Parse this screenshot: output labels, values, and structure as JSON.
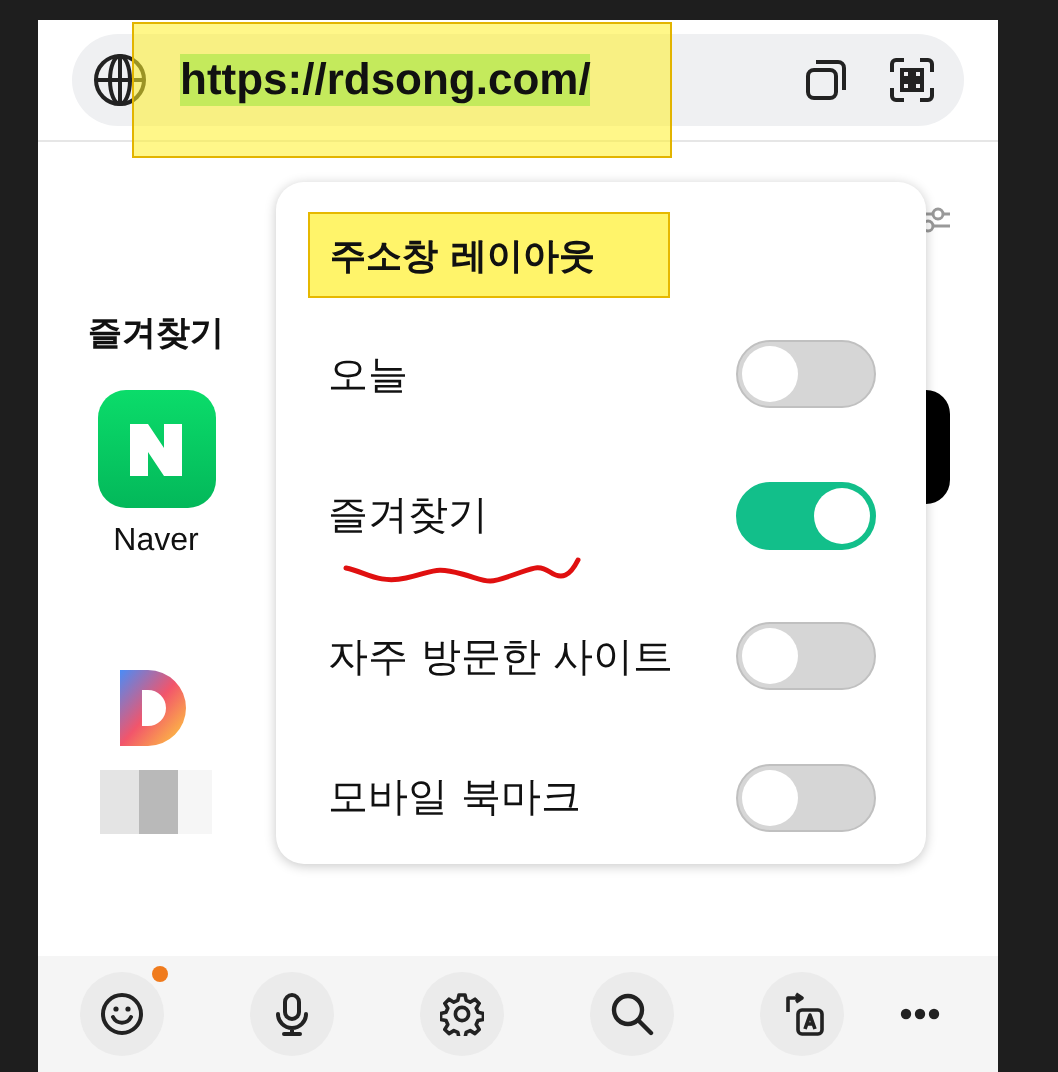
{
  "address_bar": {
    "url": "https://rdsong.com/",
    "highlighted": true
  },
  "favorites": {
    "title": "즐겨찾기",
    "items": [
      {
        "kind": "naver",
        "label": "Naver"
      },
      {
        "kind": "daum"
      }
    ]
  },
  "popup": {
    "title": "주소창 레이아웃",
    "highlighted": true,
    "options": [
      {
        "label": "오늘",
        "on": false,
        "underlined": false
      },
      {
        "label": "즐겨찾기",
        "on": true,
        "underlined": true
      },
      {
        "label": "자주 방문한 사이트",
        "on": false,
        "underlined": false
      },
      {
        "label": "모바일 북마크",
        "on": false,
        "underlined": false
      }
    ]
  },
  "bottom_bar": {
    "buttons": [
      {
        "kind": "smiley",
        "badge": true
      },
      {
        "kind": "mic",
        "badge": false
      },
      {
        "kind": "gear",
        "badge": false
      },
      {
        "kind": "search",
        "badge": false
      },
      {
        "kind": "translate",
        "badge": false
      },
      {
        "kind": "more",
        "badge": false
      }
    ]
  }
}
